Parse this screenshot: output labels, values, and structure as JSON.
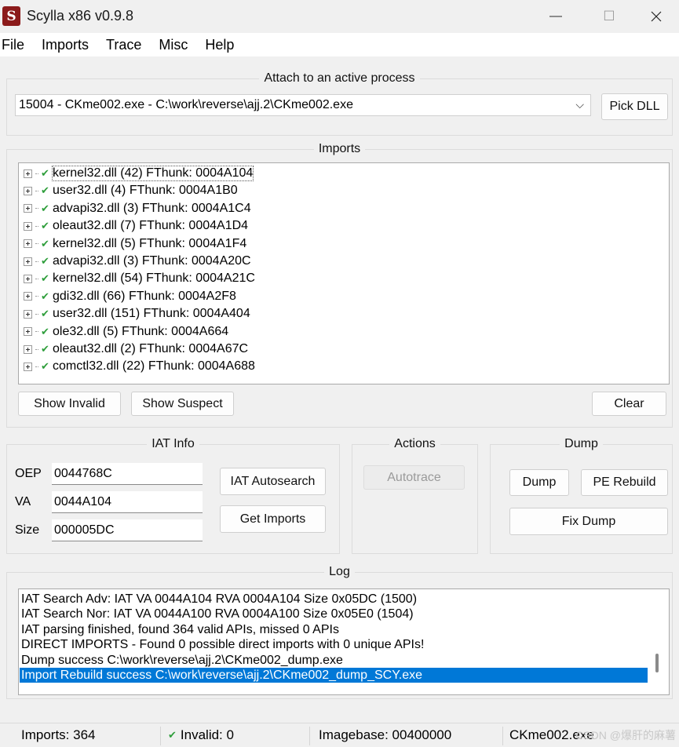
{
  "window": {
    "title": "Scylla x86 v0.9.8",
    "icon_letter": "S",
    "minimize": "—",
    "maximize": "☐"
  },
  "menu": [
    "File",
    "Imports",
    "Trace",
    "Misc",
    "Help"
  ],
  "attach": {
    "legend": "Attach to an active process",
    "process": "15004 - CKme002.exe - C:\\work\\reverse\\ajj.2\\CKme002.exe",
    "pick_dll": "Pick DLL"
  },
  "imports": {
    "legend": "Imports",
    "items": [
      "kernel32.dll (42) FThunk: 0004A104",
      "user32.dll (4) FThunk: 0004A1B0",
      "advapi32.dll (3) FThunk: 0004A1C4",
      "oleaut32.dll (7) FThunk: 0004A1D4",
      "kernel32.dll (5) FThunk: 0004A1F4",
      "advapi32.dll (3) FThunk: 0004A20C",
      "kernel32.dll (54) FThunk: 0004A21C",
      "gdi32.dll (66) FThunk: 0004A2F8",
      "user32.dll (151) FThunk: 0004A404",
      "ole32.dll (5) FThunk: 0004A664",
      "oleaut32.dll (2) FThunk: 0004A67C",
      "comctl32.dll (22) FThunk: 0004A688"
    ],
    "show_invalid": "Show Invalid",
    "show_suspect": "Show Suspect",
    "clear": "Clear"
  },
  "iat_info": {
    "legend": "IAT Info",
    "oep_label": "OEP",
    "oep": "0044768C",
    "va_label": "VA",
    "va": "0044A104",
    "size_label": "Size",
    "size": "000005DC",
    "autosearch": "IAT Autosearch",
    "get_imports": "Get Imports"
  },
  "actions": {
    "legend": "Actions",
    "autotrace": "Autotrace"
  },
  "dump": {
    "legend": "Dump",
    "dump": "Dump",
    "pe_rebuild": "PE Rebuild",
    "fix_dump": "Fix Dump"
  },
  "log": {
    "legend": "Log",
    "lines": [
      "IAT Search Adv: IAT VA 0044A104 RVA 0004A104 Size 0x05DC (1500)",
      "IAT Search Nor: IAT VA 0044A100 RVA 0004A100 Size 0x05E0 (1504)",
      "IAT parsing finished, found 364 valid APIs, missed 0 APIs",
      "DIRECT IMPORTS - Found 0 possible direct imports with 0 unique APIs!",
      "Dump success C:\\work\\reverse\\ajj.2\\CKme002_dump.exe",
      "Import Rebuild success C:\\work\\reverse\\ajj.2\\CKme002_dump_SCY.exe"
    ]
  },
  "status": {
    "imports": "Imports: 364",
    "invalid": "Invalid: 0",
    "imagebase": "Imagebase: 00400000",
    "module": "CKme002.exe"
  },
  "watermark": "CSDN @爆肝的麻薯",
  "colors": {
    "selection": "#0078d7",
    "check": "#2e9e3b",
    "icon": "#8b1a1a"
  },
  "icons": {
    "check": "✔",
    "expander": "plus-box",
    "dropdown": "⌵"
  }
}
